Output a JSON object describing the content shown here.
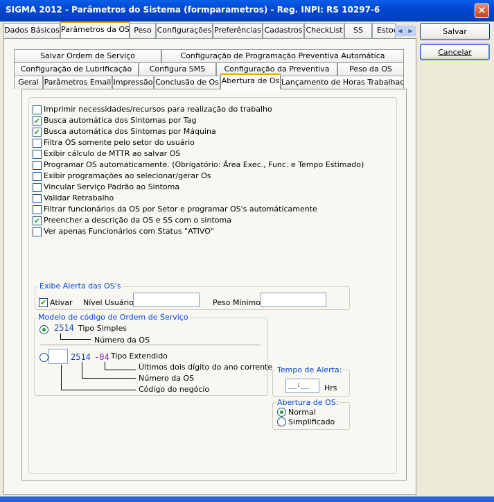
{
  "window": {
    "title": "SIGMA 2012 - Parâmetros do Sistema  (formparametros)  - Reg. INPI: RS 10297-6",
    "close_label": "✕"
  },
  "top_tabs": [
    {
      "label": "Dados Básicos"
    },
    {
      "label": "Parâmetros da OS"
    },
    {
      "label": "Peso"
    },
    {
      "label": "Configurações"
    },
    {
      "label": "Preferências"
    },
    {
      "label": "Cadastros"
    },
    {
      "label": "CheckList"
    },
    {
      "label": "SS"
    },
    {
      "label": "Estoc"
    }
  ],
  "tab_scroll": {
    "left": "◀",
    "right": "▶"
  },
  "buttons": {
    "save": "Salvar",
    "cancel": "Cancelar"
  },
  "sub_tabs": {
    "row1": [
      {
        "label": "Salvar Ordem de Serviço"
      },
      {
        "label": "Configuração de Programação Preventiva Automática"
      }
    ],
    "row2": [
      {
        "label": "Configuração de Lubrificação"
      },
      {
        "label": "Configura SMS"
      },
      {
        "label": "Configuração da Preventiva"
      },
      {
        "label": "Peso da OS"
      }
    ],
    "row3": [
      {
        "label": "Geral"
      },
      {
        "label": "Parâmetros Email"
      },
      {
        "label": "Impressão"
      },
      {
        "label": "Conclusão de Os"
      },
      {
        "label": "Abertura de Os"
      },
      {
        "label": "Lançamento de Horas Trabalhadas"
      }
    ]
  },
  "options": [
    {
      "label": "Imprimir necessidades/recursos para realização do trabalho",
      "checked": false
    },
    {
      "label": "Busca automática dos Sintomas por Tag",
      "checked": true
    },
    {
      "label": "Busca automática dos Sintomas por Máquina",
      "checked": true
    },
    {
      "label": "Filtra OS somente pelo setor do usuário",
      "checked": false
    },
    {
      "label": "Exibir cálculo de MTTR ao salvar OS",
      "checked": false
    },
    {
      "label": "Programar OS automaticamente. (Obrigatório: Área Exec., Func. e Tempo Estimado)",
      "checked": false
    },
    {
      "label": "Exibir programações ao selecionar/gerar Os",
      "checked": false
    },
    {
      "label": "Vincular Serviço Padrão ao Sintoma",
      "checked": false
    },
    {
      "label": "Validar Retrabalho",
      "checked": false
    },
    {
      "label": "Filtrar funcionários da OS por Setor e programar OS's automáticamente",
      "checked": false
    },
    {
      "label": "Preencher a descrição da OS e SS com o sintoma",
      "checked": true
    },
    {
      "label": "Ver apenas Funcionários com Status \"ATIVO\"",
      "checked": false
    }
  ],
  "check_mark": "✔",
  "alert_group": {
    "title": "Exibe Alerta das OS's",
    "activate_label": "Ativar",
    "activate_checked": true,
    "user_level_label": "Nível Usuário",
    "user_level_value": "",
    "min_weight_label": "Peso Mínimo d",
    "min_weight_value": ""
  },
  "model_group": {
    "title": "Modelo de código de Ordem de Serviço",
    "simple_selected": true,
    "simple_code": "2514",
    "simple_type": "Tipo Simples",
    "simple_desc": "Número da OS",
    "extended_selected": false,
    "extended_code": "2514",
    "extended_suffix": "-04",
    "extended_type": "Tipo Extendido",
    "extended_desc_year": "Últimos dois dígito do ano corrente",
    "extended_desc_number": "Número da OS",
    "extended_desc_business": "Código do negócio"
  },
  "alert_time": {
    "title": "Tempo de Alerta:",
    "value": "__:__",
    "unit": "Hrs"
  },
  "opening_mode": {
    "title": "Abertura de OS:",
    "options": [
      {
        "label": "Normal",
        "selected": true
      },
      {
        "label": "Simplificado",
        "selected": false
      }
    ]
  },
  "colors": {
    "title_bar": "#0349d0",
    "group_label": "#0046d5",
    "check_green": "#21a121",
    "code_blue": "#1f3fb8",
    "suffix_purple": "#8b1fa8"
  }
}
